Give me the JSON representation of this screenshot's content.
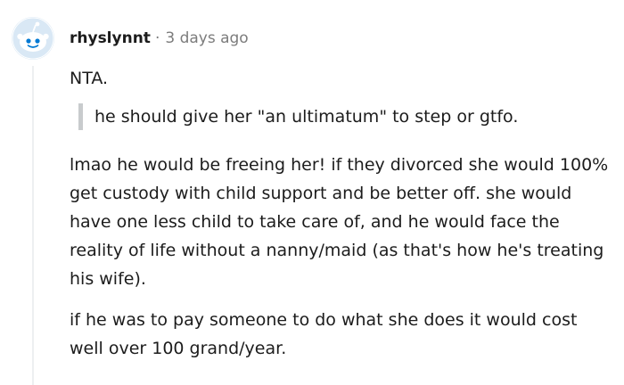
{
  "comment": {
    "username": "rhyslynnt",
    "separator": "·",
    "timestamp": "3 days ago",
    "avatar_icon": "snoo-avatar-icon",
    "colors": {
      "avatar_background": "#d9e8f5",
      "avatar_accent": "#0079d3",
      "text": "#1c1c1c",
      "meta": "#7c7c7c",
      "quote_border": "#c8cbcd",
      "thread_line": "#edeff1"
    },
    "paragraphs": {
      "verdict": "NTA.",
      "quote": "he should give her \"an ultimatum\" to step or gtfo.",
      "main": "lmao he would be freeing her! if they divorced she would 100% get custody with child support and be better off. she would have one less child to take care of, and he would face the reality of life without a nanny/maid (as that's how he's treating his wife).",
      "closing": "if he was to pay someone to do what she does it would cost well over 100 grand/year."
    }
  }
}
